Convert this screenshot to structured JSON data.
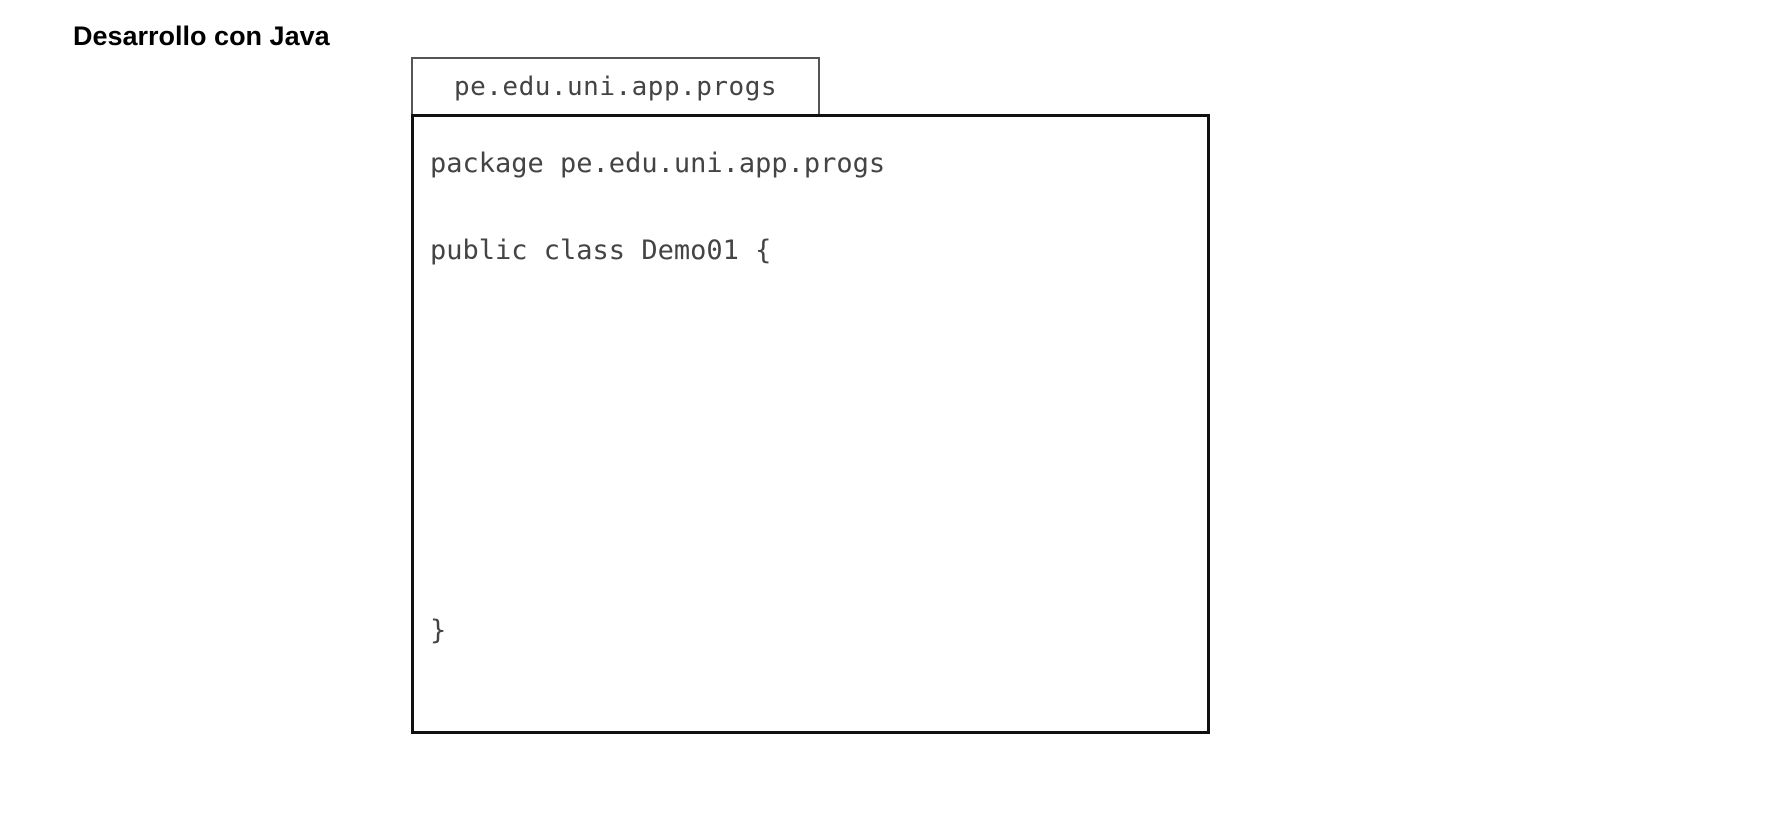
{
  "title": "Desarrollo con Java",
  "package_tab": {
    "label": "pe.edu.uni.app.progs"
  },
  "code": {
    "package_line": "package pe.edu.uni.app.progs",
    "class_line": "public class Demo01 {",
    "closing_line": "}"
  }
}
